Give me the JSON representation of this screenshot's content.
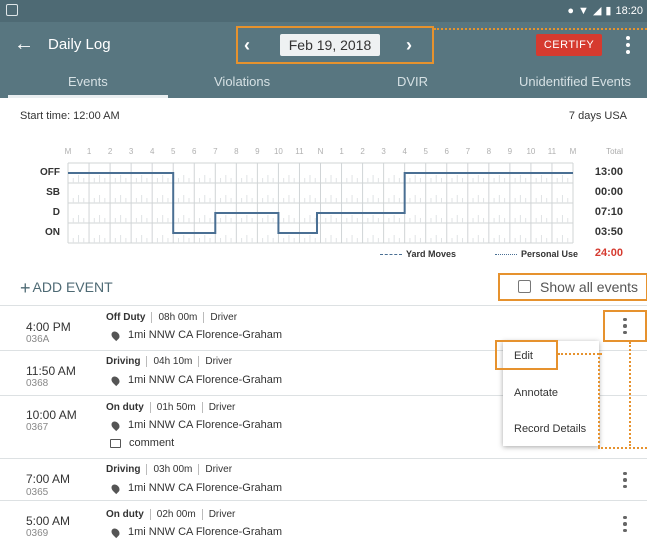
{
  "status_bar": {
    "time": "18:20"
  },
  "app_bar": {
    "title": "Daily Log",
    "date": "Feb 19, 2018",
    "certify_label": "CERTIFY"
  },
  "tabs": [
    "Events",
    "Violations",
    "DVIR",
    "Unidentified Events"
  ],
  "log_header": {
    "start_time": "Start time: 12:00 AM",
    "ruleset": "7 days USA"
  },
  "grid": {
    "hour_labels": [
      "M",
      "1",
      "2",
      "3",
      "4",
      "5",
      "6",
      "7",
      "8",
      "9",
      "10",
      "11",
      "N",
      "1",
      "2",
      "3",
      "4",
      "5",
      "6",
      "7",
      "8",
      "9",
      "10",
      "11",
      "M"
    ],
    "status_labels": [
      "OFF",
      "SB",
      "D",
      "ON"
    ],
    "total_header": "Total",
    "totals": [
      "13:00",
      "00:00",
      "07:10",
      "03:50"
    ],
    "grand_total": "24:00",
    "legend": {
      "yard_moves": "Yard Moves",
      "personal_use": "Personal Use"
    },
    "line_color": "#4a6f93"
  },
  "add_event_label": "ADD EVENT",
  "show_all_label": "Show all events",
  "events": [
    {
      "time": "4:00 PM",
      "code": "036A",
      "status": "Off Duty",
      "duration": "08h 00m",
      "role": "Driver",
      "location": "1mi NNW CA Florence-Graham"
    },
    {
      "time": "11:50 AM",
      "code": "0368",
      "status": "Driving",
      "duration": "04h 10m",
      "role": "Driver",
      "location": "1mi NNW CA Florence-Graham"
    },
    {
      "time": "10:00 AM",
      "code": "0367",
      "status": "On duty",
      "duration": "01h 50m",
      "role": "Driver",
      "location": "1mi NNW CA Florence-Graham",
      "comment": "comment"
    },
    {
      "time": "7:00 AM",
      "code": "0365",
      "status": "Driving",
      "duration": "03h 00m",
      "role": "Driver",
      "location": "1mi NNW CA Florence-Graham"
    },
    {
      "time": "5:00 AM",
      "code": "0369",
      "status": "On duty",
      "duration": "02h 00m",
      "role": "Driver",
      "location": "1mi NNW CA Florence-Graham"
    }
  ],
  "context_menu": {
    "items": [
      "Edit",
      "Annotate",
      "Record Details"
    ]
  },
  "colors": {
    "app_bar": "#587680",
    "certify": "#d63a2f",
    "highlight": "#e6922e"
  }
}
